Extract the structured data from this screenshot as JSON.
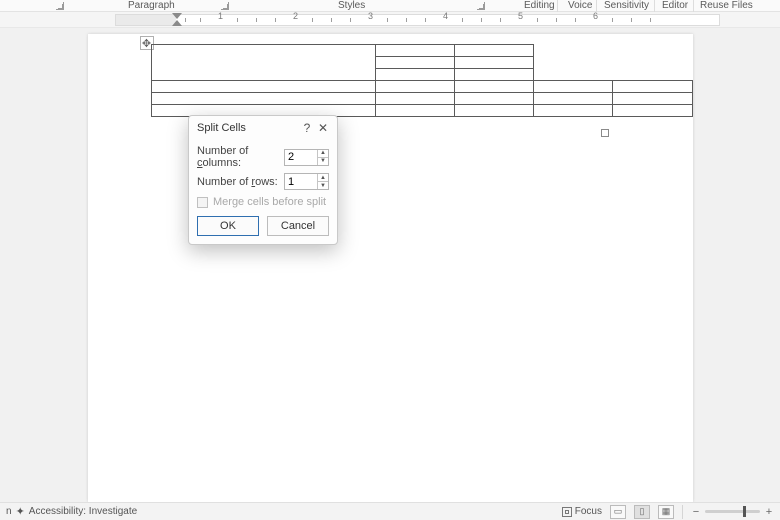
{
  "ribbon": {
    "groups": {
      "paragraph": "Paragraph",
      "styles": "Styles",
      "editing": "Editing",
      "voice": "Voice",
      "sensitivity": "Sensitivity",
      "editor": "Editor",
      "reuse": "Reuse Files"
    }
  },
  "ruler": {
    "marks": [
      "1",
      "2",
      "3",
      "4",
      "5",
      "6"
    ]
  },
  "table_anchor": "✥",
  "dialog": {
    "title": "Split Cells",
    "help": "?",
    "close": "✕",
    "cols_label_pre": "Number of ",
    "cols_label_u": "c",
    "cols_label_post": "olumns:",
    "cols_value": "2",
    "rows_label_pre": "Number of ",
    "rows_label_u": "r",
    "rows_label_post": "ows:",
    "rows_value": "1",
    "merge_label": "Merge cells before split",
    "ok": "OK",
    "cancel": "Cancel"
  },
  "status": {
    "left_trunc": "n",
    "accessibility": "Accessibility: Investigate",
    "focus": "Focus",
    "zoom_minus": "−",
    "zoom_plus": "+"
  }
}
